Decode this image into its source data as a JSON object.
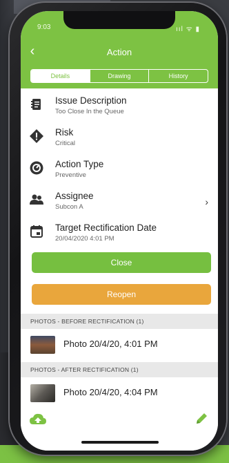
{
  "status_bar": {
    "time": "9:03",
    "right": "ııl ᯤ ▮"
  },
  "header": {
    "title": "Action",
    "back_glyph": "‹",
    "tabs": [
      {
        "label": "Details",
        "active": true
      },
      {
        "label": "Drawing",
        "active": false
      },
      {
        "label": "History",
        "active": false
      }
    ]
  },
  "fields": [
    {
      "icon": "note-icon",
      "label": "Issue Description",
      "value": "Too Close In the Queue"
    },
    {
      "icon": "warning-diamond-icon",
      "label": "Risk",
      "value": "Critical"
    },
    {
      "icon": "gauge-icon",
      "label": "Action Type",
      "value": "Preventive"
    },
    {
      "icon": "people-icon",
      "label": "Assignee",
      "value": "Subcon A",
      "chevron": "›"
    },
    {
      "icon": "calendar-icon",
      "label": "Target Rectification Date",
      "value": "20/04/2020 4:01 PM"
    }
  ],
  "buttons": {
    "close": "Close",
    "reopen": "Reopen"
  },
  "photos_before": {
    "header": "PHOTOS - BEFORE RECTIFICATION (1)",
    "items": [
      "Photo 20/4/20, 4:01 PM"
    ]
  },
  "photos_after": {
    "header": "PHOTOS - AFTER RECTIFICATION (1)",
    "items": [
      "Photo 20/4/20, 4:04 PM"
    ]
  },
  "colors": {
    "brand_green": "#7dc243",
    "reopen_orange": "#e9a63c",
    "section_gray": "#e8e8e8"
  },
  "bottom_bar": {
    "left_icon": "cloud-upload-icon",
    "right_icon": "pencil-icon"
  }
}
